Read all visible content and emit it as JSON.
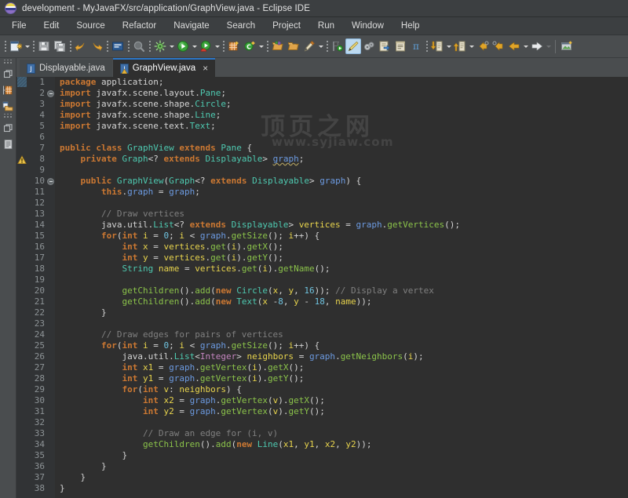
{
  "window": {
    "title": "development - MyJavaFX/src/application/GraphView.java - Eclipse IDE",
    "logo_icon": "eclipse-logo-icon"
  },
  "menubar": {
    "items": [
      {
        "label": "File"
      },
      {
        "label": "Edit"
      },
      {
        "label": "Source"
      },
      {
        "label": "Refactor"
      },
      {
        "label": "Navigate"
      },
      {
        "label": "Search"
      },
      {
        "label": "Project"
      },
      {
        "label": "Run"
      },
      {
        "label": "Window"
      },
      {
        "label": "Help"
      }
    ]
  },
  "toolbar": {
    "buttons": [
      {
        "name": "new-wizard-icon",
        "tooltip": "New"
      },
      {
        "name": "save-icon",
        "tooltip": "Save"
      },
      {
        "name": "save-all-icon",
        "tooltip": "Save All"
      },
      {
        "name": "undo-arrow-icon",
        "tooltip": "Undo"
      },
      {
        "name": "redo-arrow-icon",
        "tooltip": "Redo"
      },
      {
        "name": "console-icon",
        "tooltip": "Open Console"
      },
      {
        "name": "search-icon",
        "tooltip": "Search"
      },
      {
        "name": "debug-icon",
        "tooltip": "Debug"
      },
      {
        "name": "run-icon",
        "tooltip": "Run"
      },
      {
        "name": "coverage-icon",
        "tooltip": "Coverage"
      },
      {
        "name": "new-java-project-icon",
        "tooltip": "New Java Project"
      },
      {
        "name": "new-class-icon",
        "tooltip": "New Java Class"
      },
      {
        "name": "open-type-icon",
        "tooltip": "Open Type"
      },
      {
        "name": "open-task-icon",
        "tooltip": "Open Task"
      },
      {
        "name": "edit-pencil-icon",
        "tooltip": "Edit"
      },
      {
        "name": "skip-breakpoints-icon",
        "tooltip": "Skip All Breakpoints"
      },
      {
        "name": "toggle-mark-occurrences-icon",
        "tooltip": "Toggle Mark Occurrences",
        "selected": true
      },
      {
        "name": "external-tools-icon",
        "tooltip": "External Tools"
      },
      {
        "name": "next-annotation-icon",
        "tooltip": "Next Annotation"
      },
      {
        "name": "previous-annotation-icon",
        "tooltip": "Previous Annotation"
      },
      {
        "name": "pi-icon",
        "tooltip": "Pi"
      },
      {
        "name": "step-into-icon",
        "tooltip": "Step Into"
      },
      {
        "name": "step-return-icon",
        "tooltip": "Step Return"
      },
      {
        "name": "back-arrow-icon",
        "tooltip": "Back"
      },
      {
        "name": "forward-arrow-icon",
        "tooltip": "Forward"
      },
      {
        "name": "previous-edit-icon",
        "tooltip": "Previous Edit Location"
      },
      {
        "name": "next-edit-icon",
        "tooltip": "Next Edit Location"
      },
      {
        "name": "new-window-icon",
        "tooltip": "New Window"
      }
    ]
  },
  "rail": {
    "items": [
      {
        "name": "restore-package-explorer-icon",
        "label": "Restore"
      },
      {
        "name": "package-explorer-icon",
        "label": "Package Explorer"
      },
      {
        "name": "project-explorer-icon",
        "label": "Project Explorer"
      },
      {
        "name": "restore-outline-icon",
        "label": "Restore"
      },
      {
        "name": "outline-view-icon",
        "label": "Outline"
      }
    ]
  },
  "tabs": [
    {
      "label": "Displayable.java",
      "active": false,
      "closable": false,
      "icon": "java-file-icon"
    },
    {
      "label": "GraphView.java",
      "active": true,
      "closable": true,
      "icon": "java-file-warning-icon",
      "close_label": "×"
    }
  ],
  "editor": {
    "file": "GraphView.java",
    "total_lines": 38,
    "gutter_lines": [
      "1",
      "2",
      "3",
      "4",
      "5",
      "6",
      "7",
      "8",
      "9",
      "10",
      "11",
      "12",
      "13",
      "14",
      "15",
      "16",
      "17",
      "18",
      "19",
      "20",
      "21",
      "22",
      "23",
      "24",
      "25",
      "26",
      "27",
      "28",
      "29",
      "30",
      "31",
      "32",
      "33",
      "34",
      "35",
      "36",
      "37",
      "38"
    ],
    "markers": [
      {
        "line": 1,
        "name": "current-line-marker"
      },
      {
        "line": 8,
        "name": "warning-marker-icon"
      }
    ],
    "fold_markers": [
      {
        "line": 2,
        "name": "fold-collapse-icon"
      },
      {
        "line": 10,
        "name": "fold-collapse-icon"
      }
    ],
    "lines": [
      "package application;",
      "import javafx.scene.layout.Pane;",
      "import javafx.scene.shape.Circle;",
      "import javafx.scene.shape.Line;",
      "import javafx.scene.text.Text;",
      "",
      "public class GraphView extends Pane {",
      "    private Graph<? extends Displayable> graph;",
      "",
      "    public GraphView(Graph<? extends Displayable> graph) {",
      "        this.graph = graph;",
      "",
      "        // Draw vertices",
      "        java.util.List<? extends Displayable> vertices = graph.getVertices();",
      "        for(int i = 0; i < graph.getSize(); i++) {",
      "            int x = vertices.get(i).getX();",
      "            int y = vertices.get(i).getY();",
      "            String name = vertices.get(i).getName();",
      "",
      "            getChildren().add(new Circle(x, y, 16)); // Display a vertex",
      "            getChildren().add(new Text(x -8, y - 18, name));",
      "        }",
      "",
      "        // Draw edges for pairs of vertices",
      "        for(int i = 0; i < graph.getSize(); i++) {",
      "            java.util.List<Integer> neighbors = graph.getNeighbors(i);",
      "            int x1 = graph.getVertex(i).getX();",
      "            int y1 = graph.getVertex(i).getY();",
      "            for(int v: neighbors) {",
      "                int x2 = graph.getVertex(v).getX();",
      "                int y2 = graph.getVertex(v).getY();",
      "",
      "                // Draw an edge for (i, v)",
      "                getChildren().add(new Line(x1, y1, x2, y2));",
      "            }",
      "        }",
      "    }",
      "}"
    ]
  },
  "watermark": {
    "line1": "顶页之网",
    "line2": "www.syjiaw.com"
  },
  "colors": {
    "titlebar_bg": "#3c3f41",
    "toolbar_bg": "#4a4d4f",
    "editor_bg": "#2f2f2f",
    "gutter_bg": "#313335",
    "active_tab_accent": "#2c77c9",
    "keyword": "#cc7832",
    "type": "#4ec9b0",
    "method": "#8bc34a",
    "field": "#6c9ae0",
    "local_var": "#e8d44d",
    "number": "#6fc3df",
    "comment": "#808080",
    "generic_type": "#c586c0"
  }
}
